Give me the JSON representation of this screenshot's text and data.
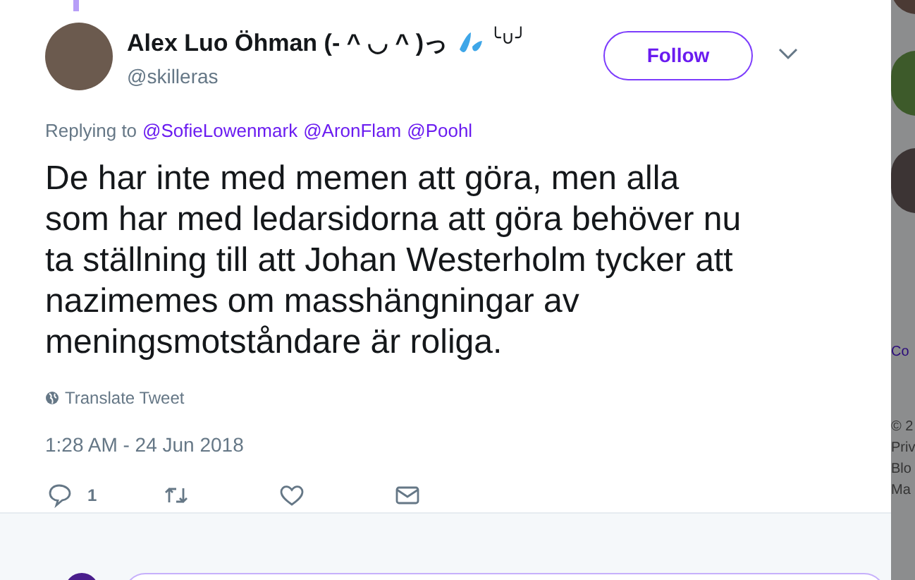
{
  "tweet": {
    "author_name": "Alex Luo Öhman (- ^ ◡ ^ )っ",
    "author_name_suffix": "╰∪╯",
    "handle": "@skilleras",
    "follow_button": "Follow",
    "replying_label": "Replying to",
    "replying_to": [
      "@SofieLowenmark",
      "@AronFlam",
      "@Poohl"
    ],
    "text": "De har inte med memen att göra, men alla som har med ledarsidorna att göra behöver nu ta ställning till att Johan Westerholm tycker att nazimemes om masshängningar av meningsmotståndare är roliga.",
    "translate": "Translate Tweet",
    "timestamp": "1:28 AM - 24 Jun 2018",
    "actions": [
      {
        "kind": "reply",
        "count": "1"
      },
      {
        "kind": "retweet"
      },
      {
        "kind": "like"
      },
      {
        "kind": "message"
      }
    ]
  },
  "background": {
    "texts": [
      "Co",
      "© 2",
      "Priv",
      "Blo",
      "Ma"
    ]
  }
}
